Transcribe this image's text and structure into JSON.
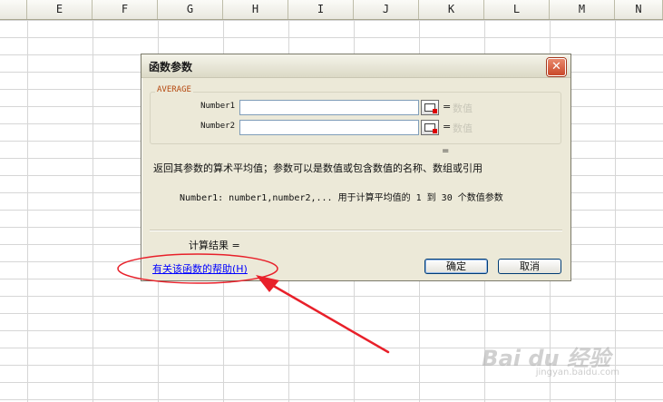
{
  "spreadsheet": {
    "columns": [
      "E",
      "F",
      "G",
      "H",
      "I",
      "J",
      "K",
      "L",
      "M",
      "N"
    ]
  },
  "dialog": {
    "title": "函数参数",
    "close_glyph": "✕",
    "function_name": "AVERAGE",
    "args": [
      {
        "label": "Number1",
        "value": "",
        "eq": "=",
        "hint": "数值"
      },
      {
        "label": "Number2",
        "value": "",
        "eq": "=",
        "hint": "数值"
      }
    ],
    "result_eq": "=",
    "description": "返回其参数的算术平均值；参数可以是数值或包含数值的名称、数组或引用",
    "param_help": "Number1:   number1,number2,... 用于计算平均值的 1 到 30 个数值参数",
    "calc_result": "计算结果 =",
    "help_link": "有关该函数的帮助(H)",
    "ok_label": "确定",
    "cancel_label": "取消"
  },
  "watermark": {
    "main": "Bai du 经验",
    "sub": "jingyan.baidu.com"
  },
  "colors": {
    "annotation": "#e8202a",
    "link": "#0000ff",
    "dialog_bg": "#ece9d8"
  }
}
